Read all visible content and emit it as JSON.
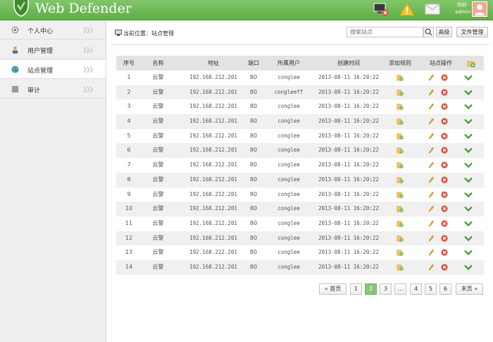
{
  "app": {
    "title": "Web Defender"
  },
  "header": {
    "greeting": "你好-",
    "username": "admin"
  },
  "sidebar": {
    "items": [
      {
        "label": "个人中心",
        "icon": "gear-icon"
      },
      {
        "label": "用户管理",
        "icon": "user-icon"
      },
      {
        "label": "站点管理",
        "icon": "globe-icon"
      },
      {
        "label": "审计",
        "icon": "audit-icon"
      }
    ],
    "active_index": 2
  },
  "breadcrumb": {
    "label": "当前位置：站点管理"
  },
  "toolbar": {
    "search_placeholder": "搜索站点",
    "advanced_label": "高级",
    "file_manage_label": "文件管理"
  },
  "table": {
    "headers": {
      "no": "序号",
      "name": "名称",
      "addr": "地址",
      "port": "端口",
      "user": "所属用户",
      "time": "创建时间",
      "rule": "添加规则",
      "ops": "站点操作"
    },
    "rows": [
      {
        "no": "1",
        "name": "云警",
        "addr": "192.168.212.201",
        "port": "80",
        "user": "conglee",
        "time": "2013-08-11 16:20:22"
      },
      {
        "no": "2",
        "name": "云警",
        "addr": "192.168.212.201",
        "port": "80",
        "user": "congleeff",
        "time": "2013-08-11 16:20:22"
      },
      {
        "no": "3",
        "name": "云警",
        "addr": "192.168.212.201",
        "port": "80",
        "user": "conglee",
        "time": "2013-08-11 16:20:22"
      },
      {
        "no": "4",
        "name": "云警",
        "addr": "192.168.212.201",
        "port": "80",
        "user": "conglee",
        "time": "2013-08-11 16:20:22"
      },
      {
        "no": "5",
        "name": "云警",
        "addr": "192.168.212.201",
        "port": "80",
        "user": "conglee",
        "time": "2013-08-11 16:20:22"
      },
      {
        "no": "6",
        "name": "云警",
        "addr": "192.168.212.201",
        "port": "80",
        "user": "conglee",
        "time": "2013-08-11 16:20:22"
      },
      {
        "no": "7",
        "name": "云警",
        "addr": "192.168.212.201",
        "port": "80",
        "user": "conglee",
        "time": "2013-08-11 16:20:22"
      },
      {
        "no": "8",
        "name": "云警",
        "addr": "192.168.212.201",
        "port": "80",
        "user": "conglee",
        "time": "2013-08-11 16:20:22"
      },
      {
        "no": "9",
        "name": "云警",
        "addr": "192.168.212.201",
        "port": "80",
        "user": "conglee",
        "time": "2013-08-11 16:20:22"
      },
      {
        "no": "10",
        "name": "云警",
        "addr": "192.168.212.201",
        "port": "80",
        "user": "conglee",
        "time": "2013-08-11 16:20:22"
      },
      {
        "no": "11",
        "name": "云警",
        "addr": "192.168.212.201",
        "port": "80",
        "user": "conglee",
        "time": "2013-08-11 16:20:22"
      },
      {
        "no": "12",
        "name": "云警",
        "addr": "192.168.212.201",
        "port": "80",
        "user": "conglee",
        "time": "2013-08-11 16:20:22"
      },
      {
        "no": "13",
        "name": "云警",
        "addr": "192.168.212.201",
        "port": "80",
        "user": "conglee",
        "time": "2013-08-11 16:20:22"
      },
      {
        "no": "14",
        "name": "云警",
        "addr": "192.168.212.201",
        "port": "80",
        "user": "conglee",
        "time": "2013-08-11 16:20:22"
      }
    ]
  },
  "pagination": {
    "first_label": "« 首页",
    "last_label": "末页 »",
    "pages": [
      "1",
      "2",
      "3",
      "...",
      "4",
      "5",
      "6"
    ],
    "current": "2"
  },
  "colors": {
    "header_green": "#6cb852",
    "active_page": "#8cc57a",
    "delete_red": "#d9533f",
    "check_green": "#3f9a2c",
    "pencil_orange": "#e8a23a"
  }
}
